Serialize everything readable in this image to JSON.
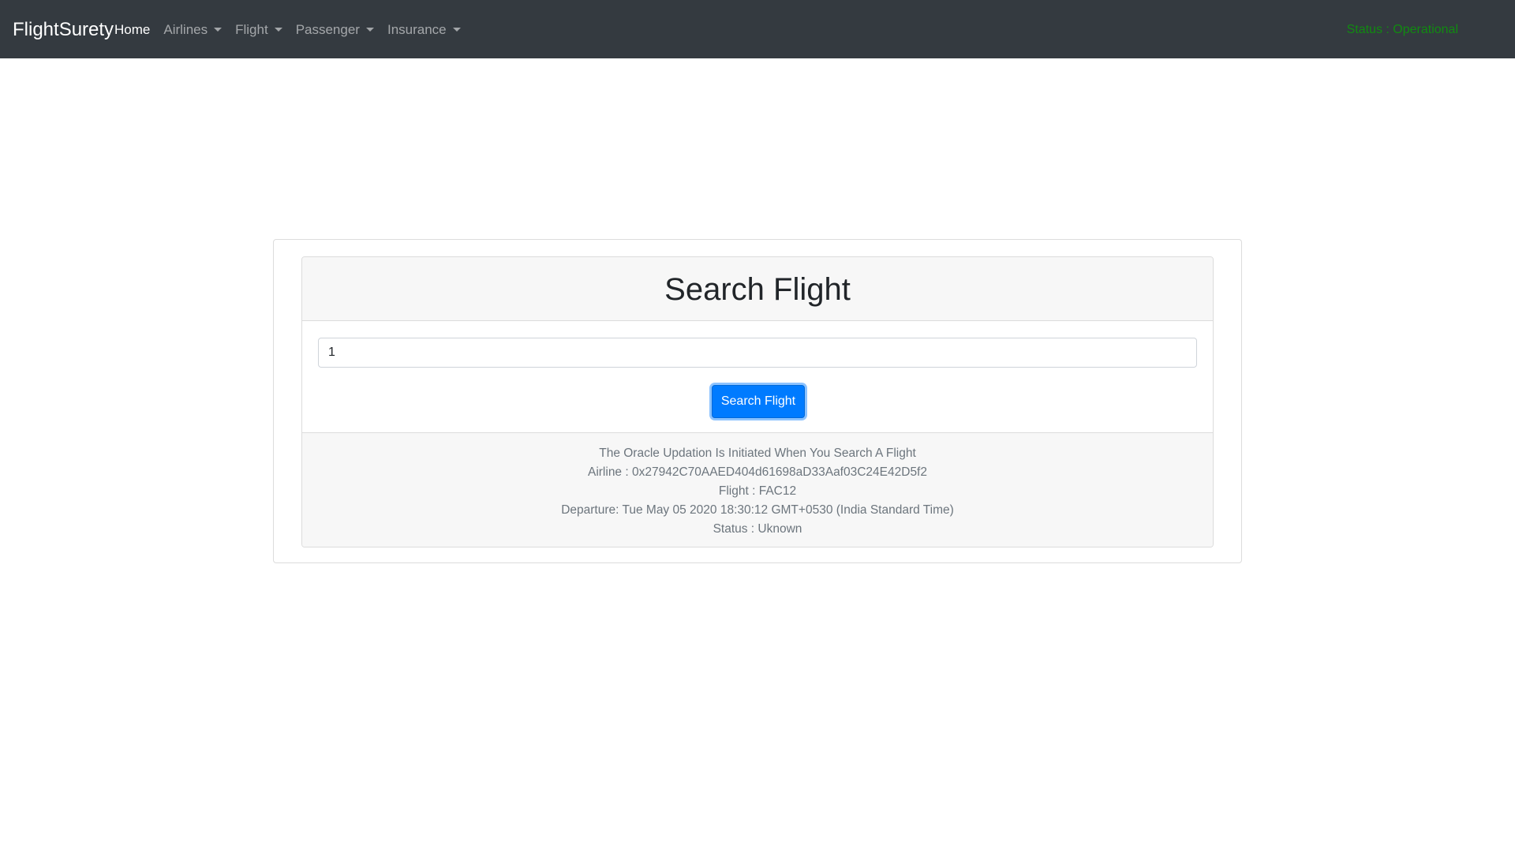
{
  "navbar": {
    "brand": "FlightSurety",
    "items": [
      {
        "label": "Home",
        "active": true,
        "dropdown": false
      },
      {
        "label": "Airlines",
        "active": false,
        "dropdown": true
      },
      {
        "label": "Flight",
        "active": false,
        "dropdown": true
      },
      {
        "label": "Passenger",
        "active": false,
        "dropdown": true
      },
      {
        "label": "Insurance",
        "active": false,
        "dropdown": true
      }
    ],
    "status": "Status : Operational",
    "status_color": "#118a11",
    "background": "#343a40"
  },
  "search_card": {
    "title": "Search Flight",
    "input_value": "1",
    "button_label": "Search Flight",
    "button_color": "#007bff"
  },
  "result": {
    "note": "The Oracle Updation Is Initiated When You Search A Flight",
    "airline": "Airline : 0x27942C70AAED404d61698aD33Aaf03C24E42D5f2",
    "flight": "Flight : FAC12",
    "departure": "Departure: Tue May 05 2020 18:30:12 GMT+0530 (India Standard Time)",
    "status": "Status : Uknown"
  }
}
